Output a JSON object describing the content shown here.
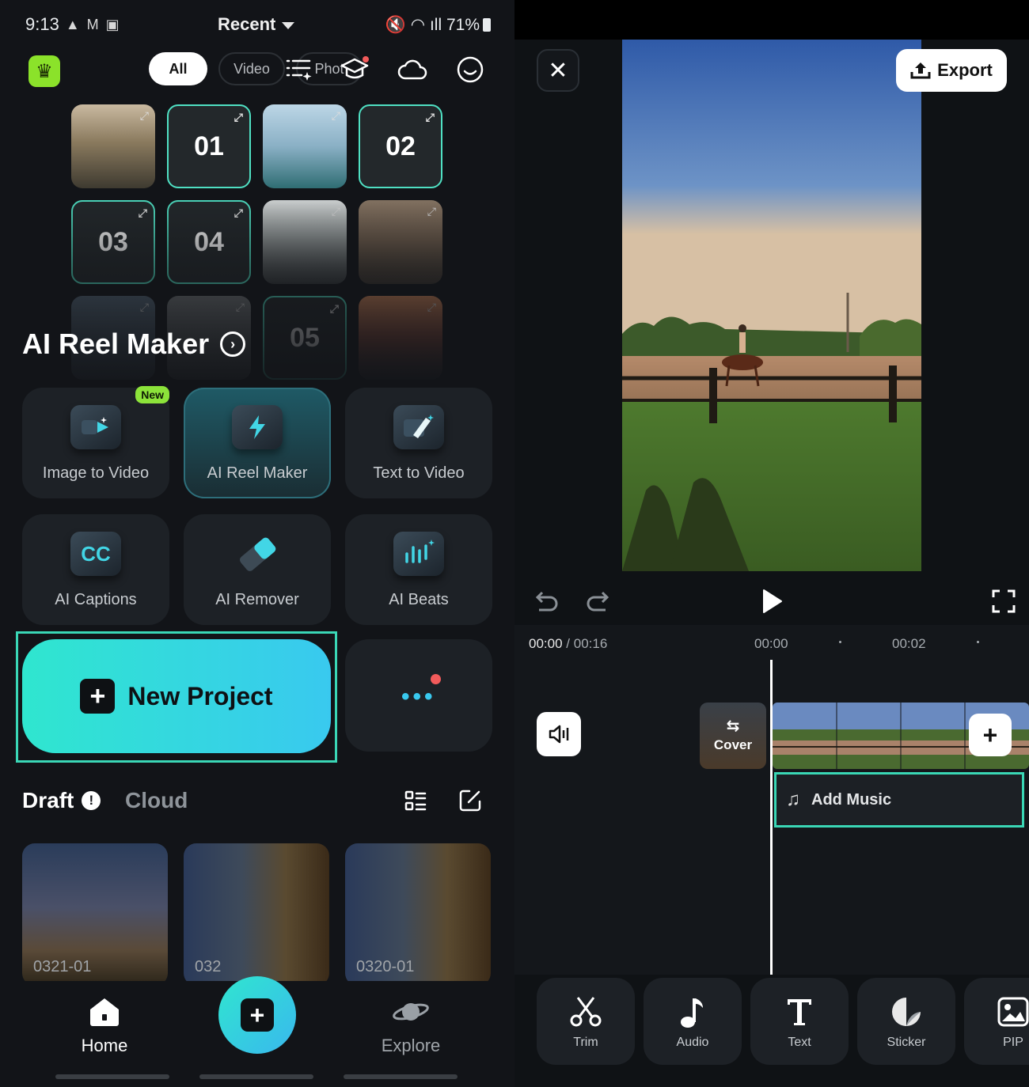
{
  "left": {
    "status_bar": {
      "time": "9:13",
      "battery": "71%",
      "title": "Recent"
    },
    "filters": {
      "all": "All",
      "video": "Video",
      "photo": "Phot"
    },
    "gallery_numbers": [
      "01",
      "02",
      "03",
      "04",
      "05"
    ],
    "section_title": "AI Reel Maker",
    "tools": [
      {
        "label": "Image to Video",
        "badge": "New"
      },
      {
        "label": "AI Reel Maker"
      },
      {
        "label": "Text to Video"
      },
      {
        "label": "AI Captions",
        "glyph": "CC"
      },
      {
        "label": "AI Remover"
      },
      {
        "label": "AI Beats"
      }
    ],
    "new_project": "New Project",
    "drafts": {
      "tab_draft": "Draft",
      "tab_cloud": "Cloud",
      "items": [
        "0321-01",
        "032",
        "0320-01"
      ]
    },
    "nav": {
      "home": "Home",
      "explore": "Explore"
    }
  },
  "right": {
    "export_label": "Export",
    "timecode": {
      "current": "00:00",
      "total": "00:16"
    },
    "ruler": [
      "00:00",
      "00:02"
    ],
    "cover_label": "Cover",
    "add_music": "Add Music",
    "tools": [
      {
        "label": "Trim",
        "icon": "scissors-icon"
      },
      {
        "label": "Audio",
        "icon": "music-note-icon"
      },
      {
        "label": "Text",
        "icon": "text-t-icon"
      },
      {
        "label": "Sticker",
        "icon": "sticker-icon"
      },
      {
        "label": "PIP",
        "icon": "pip-icon"
      }
    ]
  },
  "colors": {
    "accent": "#3ad7b6",
    "cta_from": "#2fe6cf",
    "cta_to": "#39c9ef",
    "crown_bg": "#8be22a",
    "badge": "#8ce33a"
  }
}
